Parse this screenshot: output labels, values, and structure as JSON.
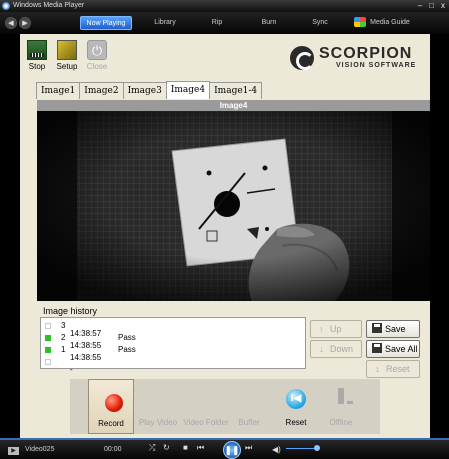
{
  "wmp": {
    "title": "Windows Media Player",
    "window_buttons": [
      "–",
      "□",
      "x"
    ],
    "nav_tabs": [
      {
        "label": "Now Playing",
        "active": true
      },
      {
        "label": "Library",
        "active": false
      },
      {
        "label": "Rip",
        "active": false
      },
      {
        "label": "Burn",
        "active": false
      },
      {
        "label": "Sync",
        "active": false
      },
      {
        "label": "Media Guide",
        "active": false
      }
    ],
    "status": {
      "media_name": "Video025",
      "time": "00:00"
    }
  },
  "toolbar": {
    "stop_label": "Stop",
    "setup_label": "Setup",
    "close_label": "Close"
  },
  "logo": {
    "brand": "SCORPION",
    "sub": "VISION SOFTWARE"
  },
  "image_tabs": [
    {
      "label": "Image1",
      "active": false
    },
    {
      "label": "Image2",
      "active": false
    },
    {
      "label": "Image3",
      "active": false
    },
    {
      "label": "Image4",
      "active": true
    },
    {
      "label": "Image1-4",
      "active": false
    }
  ],
  "viewer": {
    "title": "Image4"
  },
  "history": {
    "label": "Image history",
    "rows": [
      {
        "num": "3",
        "time": "14:38:57",
        "status": "",
        "checked": false
      },
      {
        "num": "2",
        "time": "14:38:55",
        "status": "Pass",
        "checked": true
      },
      {
        "num": "1",
        "time": "14:38:55",
        "status": "Pass",
        "checked": true
      },
      {
        "num": "",
        "time": "-",
        "status": "",
        "checked": false
      }
    ]
  },
  "history_buttons": {
    "up": "Up",
    "down": "Down",
    "save": "Save",
    "save_all": "Save All",
    "reset": "Reset"
  },
  "bottom_buttons": {
    "record": "Record",
    "play_video": "Play Video",
    "video_folder": "Video Folder",
    "buffer": "Buffer",
    "reset": "Reset",
    "offline": "Offline"
  },
  "colors": {
    "pass": "#2dc02d",
    "nav_active": "#1d5fc9",
    "record": "#e01b00"
  }
}
